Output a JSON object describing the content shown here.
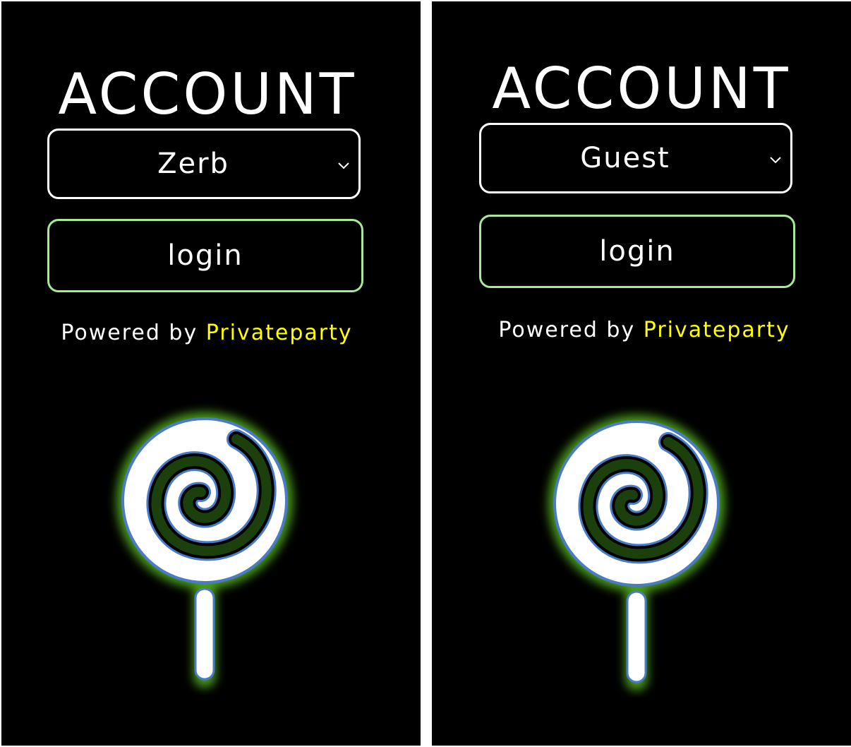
{
  "panels": [
    {
      "title": "ACCOUNT",
      "account_select": {
        "value": "Zerb"
      },
      "login_label": "login",
      "powered_by": {
        "prefix": "Powered by ",
        "brand": "Privateparty"
      }
    },
    {
      "title": "ACCOUNT",
      "account_select": {
        "value": "Guest"
      },
      "login_label": "login",
      "powered_by": {
        "prefix": "Powered by ",
        "brand": "Privateparty"
      }
    }
  ],
  "colors": {
    "background": "#000000",
    "text": "#ffffff",
    "login_border": "#a9e79a",
    "brand": "#ffff00",
    "lollipop_glow": "#4a9a1e",
    "lollipop_outline": "#4a7bc4"
  },
  "icons": {
    "chevron": "chevron-down-icon",
    "logo": "lollipop-icon"
  }
}
